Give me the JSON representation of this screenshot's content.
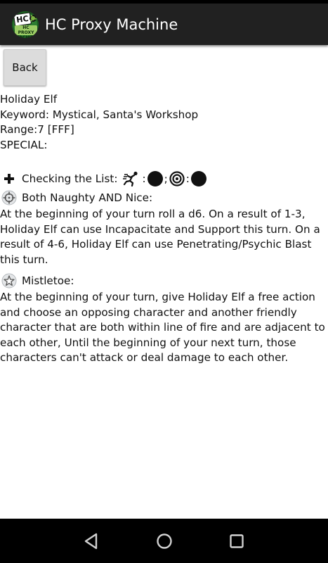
{
  "app": {
    "title": "HC Proxy Machine",
    "icon": "hc-proxy-machine-logo",
    "logo_text": "HC PROXY MACHINE"
  },
  "toolbar": {
    "back_label": "Back"
  },
  "character": {
    "name": "Holiday Elf",
    "keyword_line": "Keyword: Mystical, Santa's Workshop",
    "range_line": "Range:7 [FFF]",
    "special_label": "SPECIAL:"
  },
  "powers": [
    {
      "icon": "plus-icon",
      "name": "Checking the List:",
      "symbols_sep": ":",
      "symbols_sep2": ";",
      "symbols_sep3": ":",
      "description": ""
    },
    {
      "icon": "crosshair-icon",
      "name": "Both Naughty AND Nice:",
      "description": "At the beginning of your turn roll a d6. On a result of 1-3, Holiday Elf can use Incapacitate and Support this turn. On a result of 4-6, Holiday Elf can use Penetrating/Psychic Blast this turn."
    },
    {
      "icon": "star-icon",
      "name": "Mistletoe:",
      "description": "At the beginning of your turn, give Holiday Elf a free action and choose an opposing character and another friendly character that are both within line of fire and are adjacent to each other, Until the beginning of your next turn, those characters can't attack or deal damage to each other."
    }
  ],
  "colors": {
    "app_bar": "#212121",
    "nav_bar": "#000000",
    "button_bg": "#dcdcdc",
    "text": "#111111"
  }
}
